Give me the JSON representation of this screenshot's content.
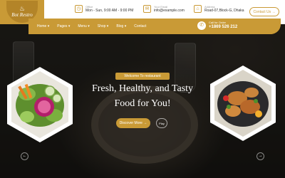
{
  "brand": {
    "name": "Bot Restro"
  },
  "topbar": {
    "hours": {
      "label": "Office",
      "value": "Mon - Sun, 9:00 AM - 9:00 PM",
      "icon": "clock-icon"
    },
    "email": {
      "label": "Your Email",
      "value": "info@example.com",
      "icon": "mail-icon"
    },
    "address": {
      "label": "Address",
      "value": "Road-07,Block-G, Dhaka",
      "icon": "home-icon"
    },
    "contact_button": "Contact Us →"
  },
  "nav": {
    "items": [
      "Home ▾",
      "Pages ▾",
      "Menu ▾",
      "Shop ▾",
      "Blog ▾",
      "Contact"
    ],
    "call_label": "Call for Order",
    "call_number": "+1869 526 212"
  },
  "hero": {
    "eyebrow": "Welcome To restaurant",
    "heading_line1": "Fresh, Healthy, and Tasty",
    "heading_line2": "Food for You!",
    "discover_button": "Discover More →",
    "play_label": "Play",
    "prev_arrow": "←",
    "next_arrow": "→"
  },
  "colors": {
    "accent": "#c99a36",
    "dark": "#1a1815",
    "white": "#ffffff"
  }
}
